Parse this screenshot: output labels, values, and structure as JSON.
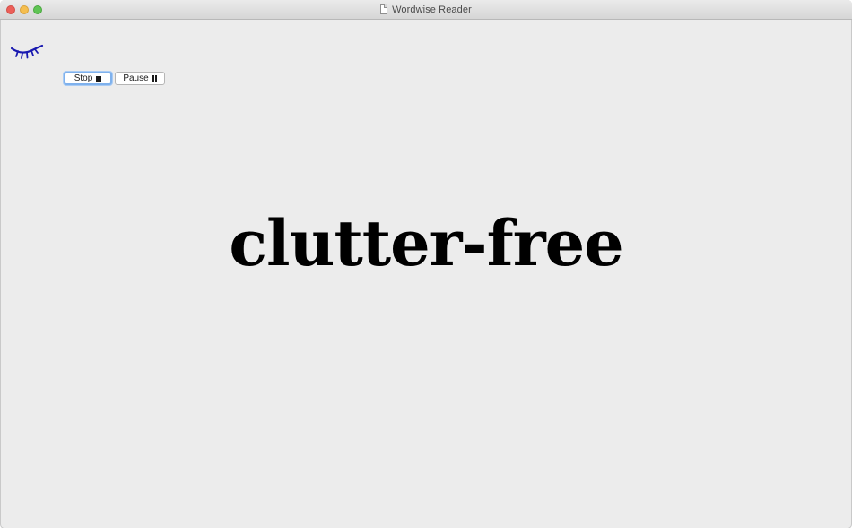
{
  "window": {
    "title": "Wordwise Reader"
  },
  "logo": {
    "icon": "closed-eye-icon",
    "color": "#1a1ab0"
  },
  "controls": {
    "stop_label": "Stop",
    "stop_icon": "stop-square-icon",
    "pause_label": "Pause",
    "pause_icon": "pause-bars-icon"
  },
  "reader": {
    "current_word": "clutter-free"
  }
}
